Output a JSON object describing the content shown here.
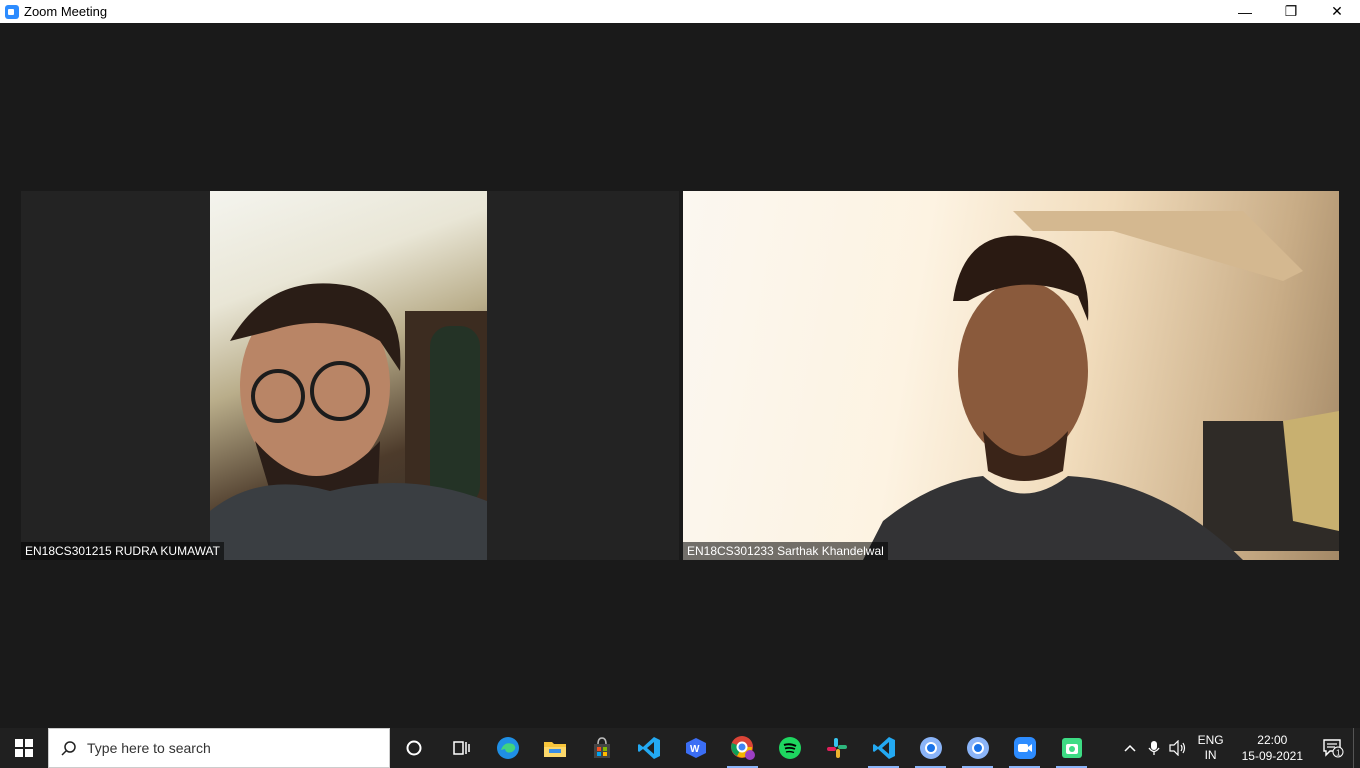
{
  "window": {
    "title": "Zoom Meeting",
    "minimize": "—",
    "restore": "❐",
    "close": "✕"
  },
  "participants": [
    {
      "name": "EN18CS301215 RUDRA KUMAWAT"
    },
    {
      "name": "EN18CS301233 Sarthak Khandelwal"
    }
  ],
  "taskbar": {
    "search_placeholder": "Type here to search",
    "apps": [
      "cortana-icon",
      "task-view-icon",
      "edge-icon",
      "file-explorer-icon",
      "store-icon",
      "vscode-icon",
      "wps-icon",
      "chrome-icon",
      "spotify-icon",
      "slack-icon",
      "vscode-icon-2",
      "chrome-profile-icon",
      "chrome-profile-icon-2",
      "zoom-icon",
      "android-studio-icon"
    ],
    "tray": {
      "lang_top": "ENG",
      "lang_bottom": "IN",
      "time": "22:00",
      "date": "15-09-2021",
      "notification_count": "1"
    }
  },
  "colors": {
    "zoom_blue": "#2d8cff",
    "taskbar": "#202020",
    "meeting_bg": "#1a1a1a"
  }
}
